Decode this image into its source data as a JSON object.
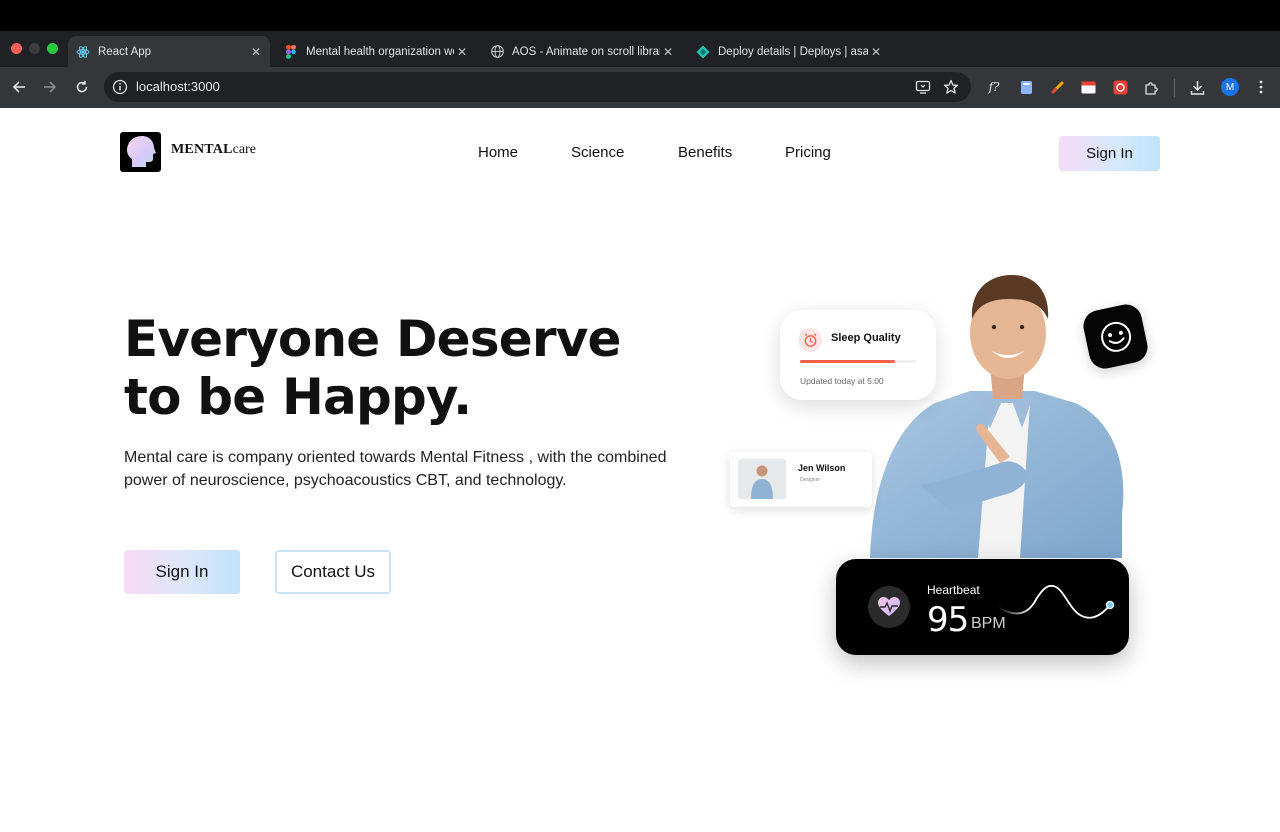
{
  "browser": {
    "tabs": [
      {
        "title": "React App",
        "active": true,
        "icon": "react-icon"
      },
      {
        "title": "Mental health organization we",
        "active": false,
        "icon": "figma-icon"
      },
      {
        "title": "AOS - Animate on scroll librar",
        "active": false,
        "icon": "globe-icon"
      },
      {
        "title": "Deploy details | Deploys | asa",
        "active": false,
        "icon": "netlify-icon"
      }
    ],
    "close_glyph": "✕",
    "new_tab_glyph": "+",
    "url": "localhost:3000",
    "profile_initial": "M"
  },
  "site": {
    "logo": {
      "bold": "MENTAL",
      "rest": "care"
    },
    "nav": [
      "Home",
      "Science",
      "Benefits",
      "Pricing"
    ],
    "nav_signin": "Sign In"
  },
  "hero": {
    "title": "Everyone Deserve to be Happy.",
    "description": "Mental care is company oriented towards Mental Fitness , with the combined power of neuroscience, psychoacoustics CBT, and technology.",
    "signin_label": "Sign In",
    "contact_label": "Contact Us"
  },
  "cards": {
    "sleep": {
      "title": "Sleep Quality",
      "updated": "Updated today at 5:00",
      "progress": 0.82,
      "color": "#f0604a"
    },
    "profile": {
      "name": "Jen Wilson",
      "role": "Designer"
    },
    "heartbeat": {
      "label": "Heartbeat",
      "value": "95",
      "unit": "BPM"
    }
  },
  "colors": {
    "accent_pink": "#f3dcf7",
    "accent_blue": "#bfe3fb",
    "chrome_dark": "#202124"
  }
}
